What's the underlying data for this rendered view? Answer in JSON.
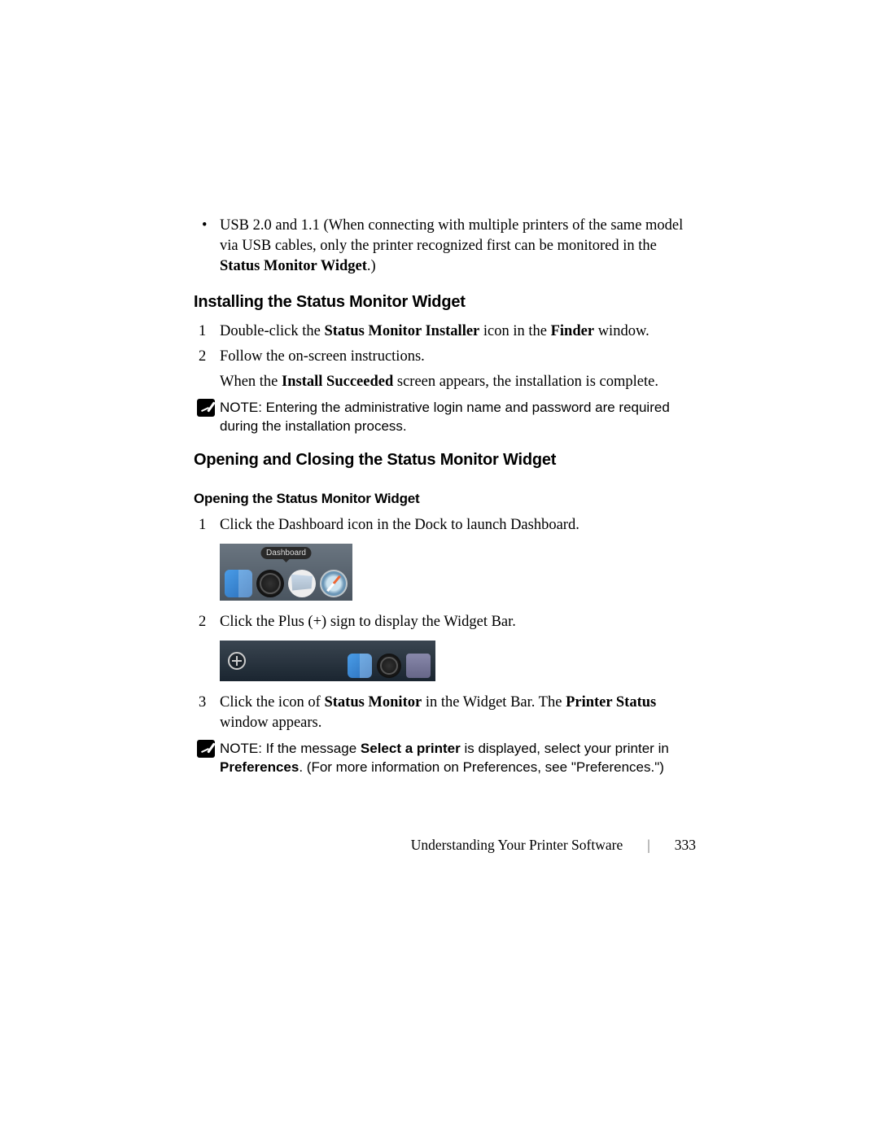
{
  "bullet": {
    "text_a": "USB 2.0 and 1.1 (When connecting with multiple printers of the same model via USB cables, only the printer recognized first can be monitored in the ",
    "text_b": "Status Monitor Widget",
    "text_c": ".)"
  },
  "sections": {
    "installing": {
      "heading": "Installing the Status Monitor Widget",
      "step1": {
        "num": "1",
        "a": "Double-click the ",
        "b": "Status Monitor Installer",
        "c": " icon in the ",
        "d": "Finder",
        "e": " window."
      },
      "step2": {
        "num": "2",
        "text": "Follow the on-screen instructions."
      },
      "sub": {
        "a": "When the ",
        "b": "Install Succeeded",
        "c": " screen appears, the installation is complete."
      },
      "note": "NOTE: Entering the administrative login name and password are required during the installation process."
    },
    "opening_closing": {
      "heading": "Opening and Closing the Status Monitor Widget",
      "sub_heading": "Opening the Status Monitor Widget",
      "step1": {
        "num": "1",
        "text": "Click the Dashboard icon in the Dock to launch Dashboard."
      },
      "fig1_label": "Dashboard",
      "step2": {
        "num": "2",
        "text": "Click the Plus (+) sign to display the Widget Bar."
      },
      "step3": {
        "num": "3",
        "a": "Click the icon of ",
        "b": "Status Monitor",
        "c": " in the Widget Bar. The ",
        "d": "Printer Status",
        "e": " window appears."
      },
      "note": {
        "a": "NOTE: If the message ",
        "b": "Select a printer",
        "c": " is displayed, select your printer in ",
        "d": "Preferences",
        "e": ". (For more information on Preferences, see \"Preferences.\")"
      }
    }
  },
  "footer": {
    "title": "Understanding Your Printer Software",
    "page": "333"
  }
}
